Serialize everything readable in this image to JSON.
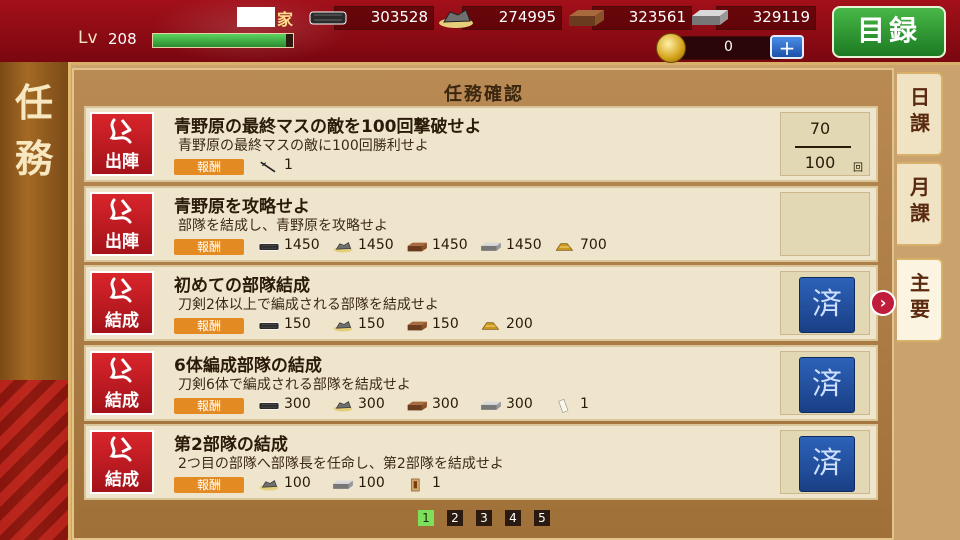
{
  "left_title": [
    "任",
    "務"
  ],
  "player": {
    "name_suffix": "家",
    "level_label": "Lv",
    "level": "208",
    "exp_fraction": 0.95
  },
  "resources": [
    {
      "name": "charcoal",
      "icon": "charcoal-icon",
      "value": "303528"
    },
    {
      "name": "whetstone",
      "icon": "whetstone-icon",
      "value": "274995"
    },
    {
      "name": "steel",
      "icon": "steel-icon",
      "value": "323561"
    },
    {
      "name": "cooling-material",
      "icon": "ingot-icon",
      "value": "329119"
    }
  ],
  "coins": {
    "value": "0",
    "add_label": "+"
  },
  "catalog_button": "目録",
  "panel_title": "任務確認",
  "quests": [
    {
      "badge": "出陣",
      "title": "青野原の最終マスの敵を100回撃破せよ",
      "desc": "青野原の最終マスの敵に100回勝利せよ",
      "reward_label": "報酬",
      "rewards": [
        {
          "icon": "sword-icon",
          "value": "1"
        }
      ],
      "status": "progress",
      "progress": {
        "current": "70",
        "target": "100",
        "unit": "回"
      }
    },
    {
      "badge": "出陣",
      "title": "青野原を攻略せよ",
      "desc": "部隊を結成し、青野原を攻略せよ",
      "reward_label": "報酬",
      "rewards": [
        {
          "icon": "charcoal-icon",
          "value": "1450"
        },
        {
          "icon": "whetstone-icon",
          "value": "1450"
        },
        {
          "icon": "steel-icon",
          "value": "1450"
        },
        {
          "icon": "ingot-icon",
          "value": "1450"
        },
        {
          "icon": "koban-icon",
          "value": "700"
        }
      ],
      "status": "empty"
    },
    {
      "badge": "結成",
      "title": "初めての部隊結成",
      "desc": "刀剣2体以上で編成される部隊を結成せよ",
      "reward_label": "報酬",
      "rewards": [
        {
          "icon": "charcoal-icon",
          "value": "150"
        },
        {
          "icon": "whetstone-icon",
          "value": "150"
        },
        {
          "icon": "steel-icon",
          "value": "150"
        },
        {
          "icon": "koban-icon",
          "value": "200"
        }
      ],
      "status": "done",
      "done_label": "済"
    },
    {
      "badge": "結成",
      "title": "6体編成部隊の結成",
      "desc": "刀剣6体で編成される部隊を結成せよ",
      "reward_label": "報酬",
      "rewards": [
        {
          "icon": "charcoal-icon",
          "value": "300"
        },
        {
          "icon": "whetstone-icon",
          "value": "300"
        },
        {
          "icon": "steel-icon",
          "value": "300"
        },
        {
          "icon": "ingot-icon",
          "value": "300"
        },
        {
          "icon": "scroll-icon",
          "value": "1"
        }
      ],
      "status": "done",
      "done_label": "済"
    },
    {
      "badge": "結成",
      "title": "第2部隊の結成",
      "desc": "2つ目の部隊へ部隊長を任命し、第2部隊を結成せよ",
      "reward_label": "報酬",
      "rewards": [
        {
          "icon": "whetstone-icon",
          "value": "100"
        },
        {
          "icon": "ingot-icon",
          "value": "100"
        },
        {
          "icon": "permit-icon",
          "value": "1"
        }
      ],
      "status": "done",
      "done_label": "済"
    }
  ],
  "tabs": [
    {
      "label": "日課",
      "active": false
    },
    {
      "label": "月課",
      "active": false
    },
    {
      "label": "主要",
      "active": true
    }
  ],
  "pages": [
    "1",
    "2",
    "3",
    "4",
    "5"
  ],
  "current_page": "1",
  "colors": {
    "header_red": "#a3101a",
    "catalog_green": "#2f9a33",
    "badge_red": "#c41a22",
    "done_blue": "#1f4c9c",
    "reward_orange": "#e38b22"
  }
}
